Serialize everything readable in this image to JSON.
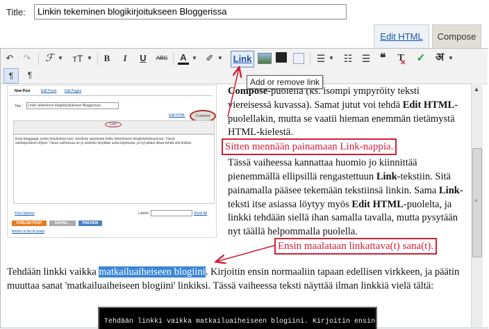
{
  "title_field": {
    "label": "Title:",
    "value": "Linkin tekeminen blogikirjoitukseen Bloggerissa"
  },
  "tabs": {
    "edit_html": "Edit HTML",
    "compose": "Compose"
  },
  "toolbar": {
    "undo": "↶",
    "redo": "↷",
    "font": "ℱ",
    "font_size": "тT",
    "bold": "B",
    "italic": "I",
    "underline": "U",
    "strike": "ABC",
    "text_color": "A",
    "highlight": "✐",
    "link": "Link",
    "quote": "❝",
    "remove_format": "T",
    "spellcheck": "✓",
    "transliterate": "अ",
    "ltr": "¶",
    "rtl": "¶"
  },
  "tooltip": "Add or remove link",
  "content": {
    "p1_part1": "Compose",
    "p1_part2": "-puolella (ks. isompi ympyröity teksti viereisessä kuvassa). Samat jutut voi tehdä ",
    "p1_part3": "Edit HTML",
    "p1_part4": "-puolellakin, mutta se vaatii hieman enemmän tietämystä HTML-kielestä.",
    "p2_part1": "Tässä vaiheessa kannattaa huomio jo kiinnittää pienemmällä ellipsillä rengastettuun ",
    "p2_part2": "Link",
    "p2_part3": "-tekstiin. Sitä painamalla pääsee tekemään tekstiinsä linkin. Sama ",
    "p2_part4": "Link",
    "p2_part5": "-teksti itse asiassa löytyy myös ",
    "p2_part6": "Edit HTML",
    "p2_part7": "-puolelta, ja linkki tehdään siellä ihan samalla tavalla, mutta pysytään nyt täällä helpommalla puolella.",
    "p3_before": "Tehdään linkki vaikka ",
    "p3_selected": "matkailuaiheiseen blogiini",
    "p3_after": ". Kirjoitin ensin normaaliin tapaan edellisen virkkeen, ja päätin muuttaa sanat 'matkailuaiheiseen blogiini' linkiksi. Tässä vaiheessa teksti näyttää ilman linkkiä vielä tältä:",
    "code_preview": "Tehdään linkki vaikka matkailuaiheiseen blogiini. Kirjoitin ensin"
  },
  "annotations": {
    "note1": "Sitten mennään painamaan Link-nappia.",
    "note2": "Ensin maalataan linkattava(t) sana(t)."
  },
  "embedded": {
    "tab_new_post": "New Post",
    "tab_edit_posts": "Edit Posts",
    "tab_edit_pages": "Edit Pages",
    "title_label": "Title:",
    "title_value": "Linkin tekeminen blogikirjoitukseen Bloggerissa",
    "edit_html": "Edit HTML",
    "compose": "Compose",
    "link": "Link",
    "body_text": "Eräs bloggaaja, jonka kirjoituksia luen, tarvitsee opastusta linkin tekemiseen blogikirjoitukseensa. Tässä sekkaperäiset ohjeet. Tässä vaiheessa on jo aloitettu kirjoittaa uutta kirjoitusta, ja nyt pitäisi alkaa tehdä sitä linkkiä.",
    "post_options": "Post Options",
    "labels": "Labels:",
    "show_all": "Show All",
    "publish": "PUBLISH POST",
    "saving": "SAVING...",
    "preview": "PREVIEW",
    "return": "Return to list of posts"
  },
  "colors": {
    "accent_red": "#d41e36",
    "selection_blue": "#3d86d6",
    "link_blue": "#1155aa"
  }
}
